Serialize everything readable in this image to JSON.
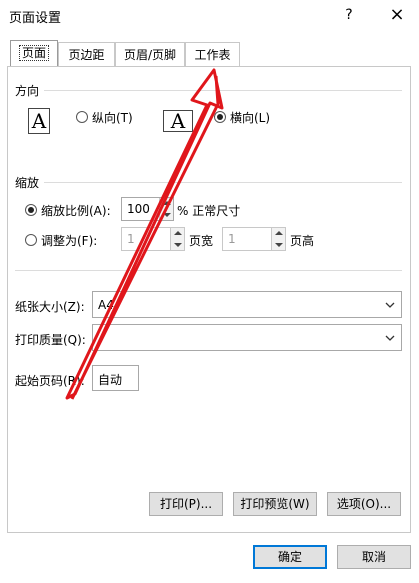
{
  "dialog": {
    "title": "页面设置",
    "help": "?",
    "close": "×"
  },
  "tabs": [
    {
      "label": "页面",
      "active": true
    },
    {
      "label": "页边距"
    },
    {
      "label": "页眉/页脚"
    },
    {
      "label": "工作表"
    }
  ],
  "orientation": {
    "section": "方向",
    "portrait_label": "纵向(T)",
    "landscape_label": "横向(L)",
    "selected": "landscape",
    "icon_letter": "A"
  },
  "scaling": {
    "section": "缩放",
    "adjust_to_label": "缩放比例(A):",
    "adjust_value": "100",
    "adjust_unit": "% 正常尺寸",
    "fit_to_label": "调整为(F):",
    "fit_wide_value": "1",
    "fit_wide_label": "页宽",
    "fit_tall_value": "1",
    "fit_tall_label": "页高"
  },
  "paper_size": {
    "label": "纸张大小(Z):",
    "value": "A4"
  },
  "print_quality": {
    "label": "打印质量(Q):",
    "value": ""
  },
  "first_page": {
    "label": "起始页码(R):",
    "value": "自动"
  },
  "actions": {
    "print": "打印(P)...",
    "preview": "打印预览(W)",
    "options": "选项(O)...",
    "ok": "确定",
    "cancel": "取消"
  },
  "colors": {
    "annotation_arrow": "#e0161b",
    "focus_border": "#0078d7"
  }
}
